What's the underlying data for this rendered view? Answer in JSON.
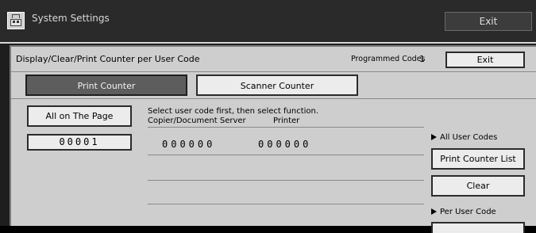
{
  "window": {
    "title": "System Settings",
    "exit_label": "Exit",
    "icon": "printer-icon"
  },
  "panel": {
    "title": "Display/Clear/Print Counter per User Code",
    "programmed_codes_label": "Programmed Codes",
    "programmed_codes_value": "1",
    "exit_label": "Exit"
  },
  "tabs": [
    {
      "label": "Print Counter",
      "selected": true
    },
    {
      "label": "Scanner Counter",
      "selected": false
    }
  ],
  "left": {
    "all_on_page_label": "All on The Page",
    "user_code": "00001"
  },
  "table": {
    "instruction": "Select user code first, then select function.",
    "headers": [
      "Copier/Document Server",
      "Printer"
    ],
    "rows": [
      {
        "copier": "000000",
        "printer": "000000"
      }
    ]
  },
  "right": {
    "all_user_codes_label": "All User Codes",
    "print_counter_list_label": "Print Counter List",
    "clear_label": "Clear",
    "per_user_code_label": "Per User Code"
  },
  "colors": {
    "panel_bg": "#cecece",
    "titlebar_bg": "#2a2a2a",
    "selected_tab_bg": "#5d5d5d",
    "button_bg": "#ececec"
  }
}
